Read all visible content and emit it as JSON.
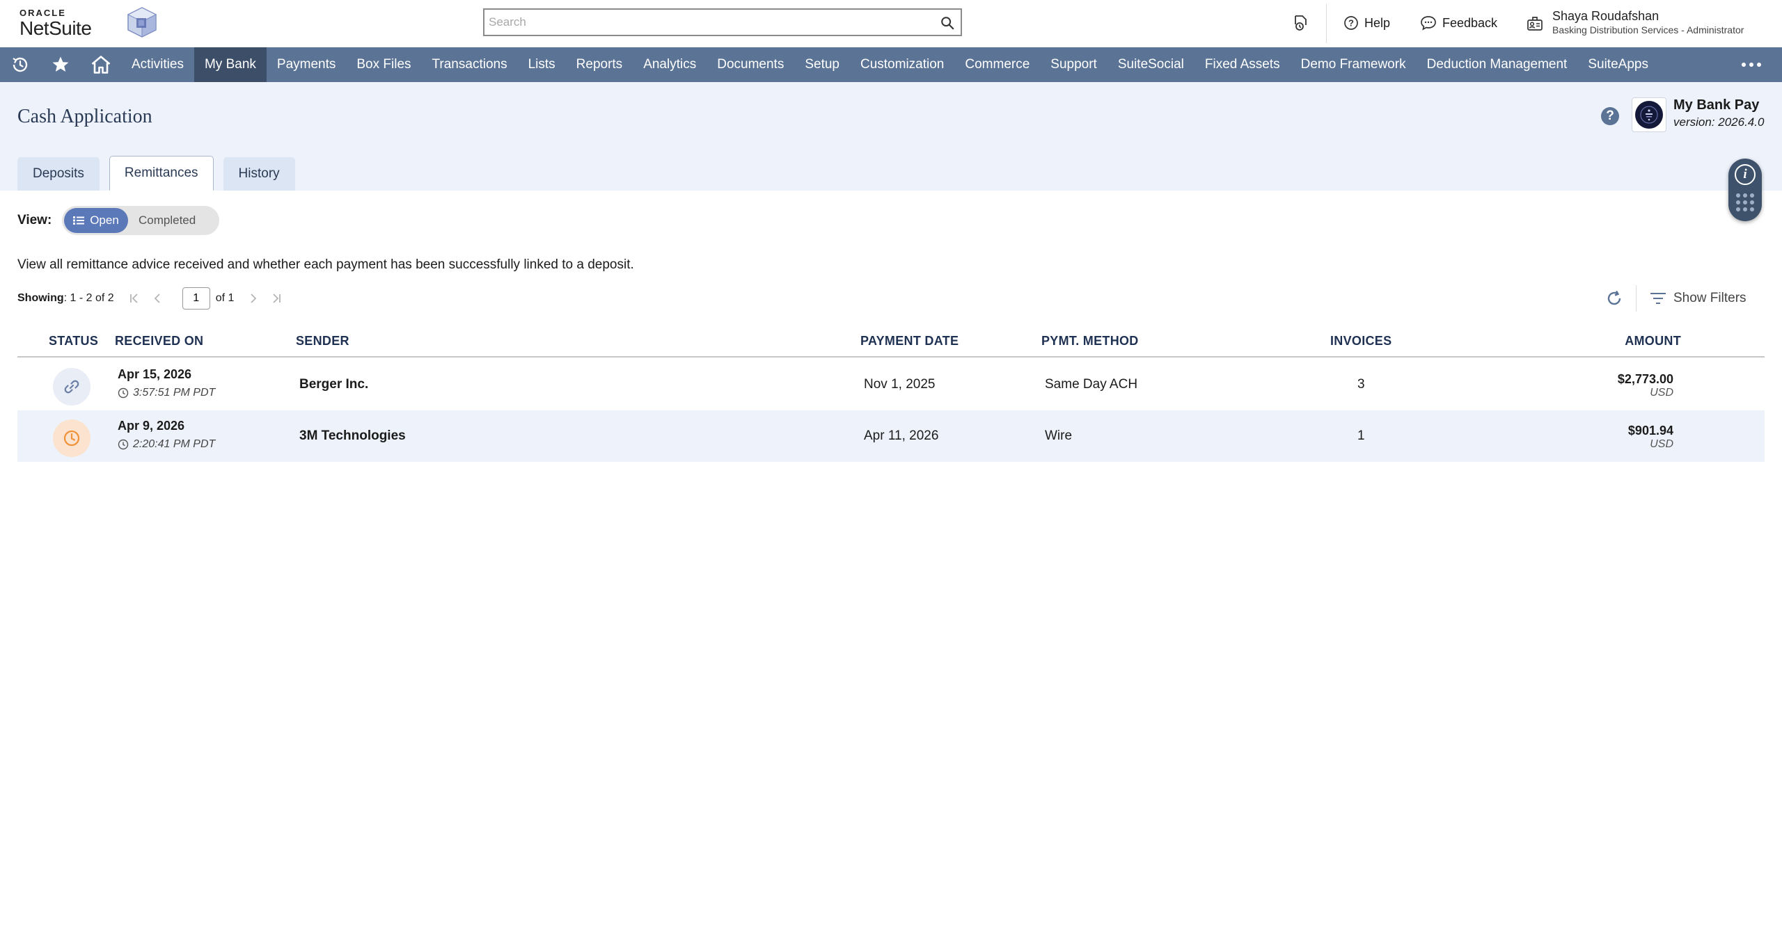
{
  "brand": {
    "oracle": "ORACLE",
    "netsuite": "NetSuite"
  },
  "search": {
    "placeholder": "Search",
    "value": ""
  },
  "header": {
    "help_label": "Help",
    "feedback_label": "Feedback",
    "user_name": "Shaya Roudafshan",
    "user_role": "Basking Distribution Services - Administrator"
  },
  "nav": {
    "items": [
      {
        "label": "Activities"
      },
      {
        "label": "My Bank"
      },
      {
        "label": "Payments"
      },
      {
        "label": "Box Files"
      },
      {
        "label": "Transactions"
      },
      {
        "label": "Lists"
      },
      {
        "label": "Reports"
      },
      {
        "label": "Analytics"
      },
      {
        "label": "Documents"
      },
      {
        "label": "Setup"
      },
      {
        "label": "Customization"
      },
      {
        "label": "Commerce"
      },
      {
        "label": "Support"
      },
      {
        "label": "SuiteSocial"
      },
      {
        "label": "Fixed Assets"
      },
      {
        "label": "Demo Framework"
      },
      {
        "label": "Deduction Management"
      },
      {
        "label": "SuiteApps"
      }
    ],
    "active": "My Bank"
  },
  "page": {
    "title": "Cash Application",
    "help_symbol": "?",
    "app_name": "My Bank Pay",
    "app_version": "version: 2026.4.0",
    "tabs": [
      {
        "label": "Deposits"
      },
      {
        "label": "Remittances"
      },
      {
        "label": "History"
      }
    ],
    "active_tab": "Remittances"
  },
  "view": {
    "label": "View:",
    "options": [
      "Open",
      "Completed"
    ],
    "selected": "Open"
  },
  "description": "View all remittance advice received and whether each payment has been successfully linked to a deposit.",
  "pager": {
    "showing_label": "Showing",
    "showing_range": ": 1 - 2 of 2",
    "current_page": "1",
    "of_pages": "of 1"
  },
  "toolbar": {
    "show_filters_label": "Show Filters"
  },
  "table": {
    "headers": {
      "status": "STATUS",
      "received_on": "RECEIVED ON",
      "sender": "SENDER",
      "payment_date": "PAYMENT DATE",
      "pymt_method": "PYMT. METHOD",
      "invoices": "INVOICES",
      "amount": "AMOUNT"
    },
    "rows": [
      {
        "status": "linked-icon",
        "received_date": "Apr 15, 2026",
        "received_time": "3:57:51 PM PDT",
        "sender": "Berger Inc.",
        "payment_date": "Nov 1, 2025",
        "method": "Same Day ACH",
        "invoices": "3",
        "amount": "$2,773.00",
        "currency": "USD"
      },
      {
        "status": "pending-clock-icon",
        "received_date": "Apr 9, 2026",
        "received_time": "2:20:41 PM PDT",
        "sender": "3M Technologies",
        "payment_date": "Apr 11, 2026",
        "method": "Wire",
        "invoices": "1",
        "amount": "$901.94",
        "currency": "USD"
      }
    ]
  },
  "colors": {
    "nav_bg": "#5b7394",
    "nav_active": "#3d4f68",
    "page_head_bg": "#eef3fb",
    "toggle_accent": "#5b78b8",
    "pending_orange": "#f0923a",
    "linked_blue": "#6a7fa6"
  }
}
